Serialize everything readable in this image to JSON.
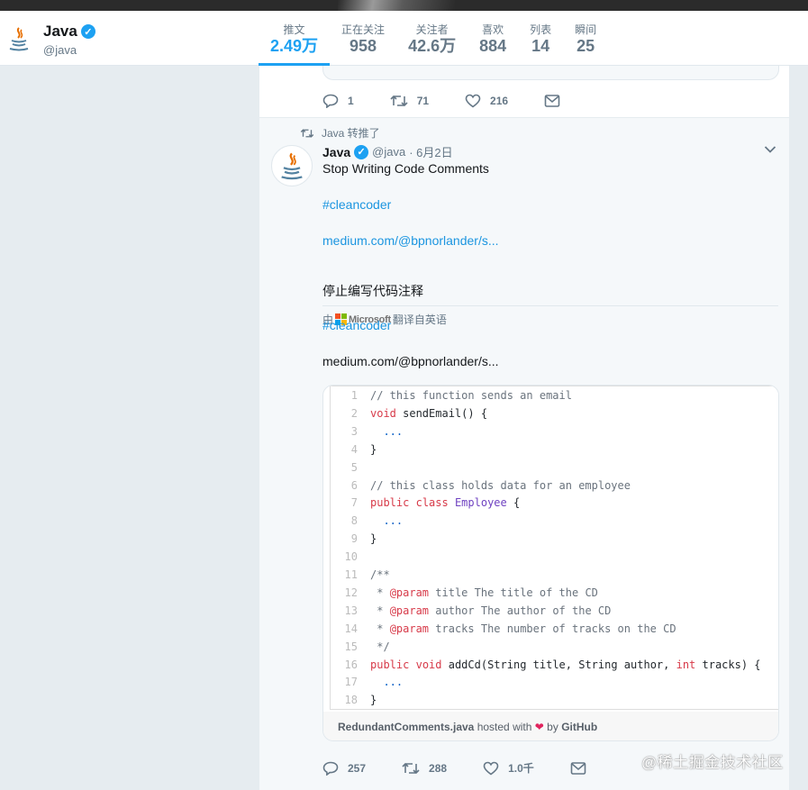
{
  "profile": {
    "name": "Java",
    "handle": "@java"
  },
  "stats": [
    {
      "label": "推文",
      "value": "2.49万"
    },
    {
      "label": "正在关注",
      "value": "958"
    },
    {
      "label": "关注者",
      "value": "42.6万"
    },
    {
      "label": "喜欢",
      "value": "884"
    },
    {
      "label": "列表",
      "value": "14"
    },
    {
      "label": "瞬间",
      "value": "25"
    }
  ],
  "prev_actions": {
    "reply": "1",
    "retweet": "71",
    "like": "216"
  },
  "tweet": {
    "retweeted_by": "Java 转推了",
    "name": "Java",
    "handle": "@java",
    "date": "· 6月2日",
    "text_line1": "Stop Writing Code Comments",
    "hashtag": "#cleancoder",
    "url": "medium.com/@bpnorlander/s...",
    "translate_prefix": "由",
    "translate_brand": "Microsoft",
    "translate_suffix": "翻译自英语",
    "translated_line1": "停止编写代码注释",
    "translated_hashtag": "#cleancoder",
    "translated_url": "medium.com/@bpnorlander/s...",
    "actions": {
      "reply": "257",
      "retweet": "288",
      "like": "1.0千"
    }
  },
  "gist": {
    "lines": [
      {
        "n": "1",
        "parts": [
          {
            "t": "// this function sends an email",
            "c": "c-com"
          }
        ]
      },
      {
        "n": "2",
        "parts": [
          {
            "t": "void",
            "c": "c-kw"
          },
          {
            "t": " sendEmail() {",
            "c": "c-pl"
          }
        ]
      },
      {
        "n": "3",
        "parts": [
          {
            "t": "  ...",
            "c": "c-dots"
          }
        ]
      },
      {
        "n": "4",
        "parts": [
          {
            "t": "}",
            "c": "c-pl"
          }
        ]
      },
      {
        "n": "5",
        "parts": []
      },
      {
        "n": "6",
        "parts": [
          {
            "t": "// this class holds data for an employee",
            "c": "c-com"
          }
        ]
      },
      {
        "n": "7",
        "parts": [
          {
            "t": "public",
            "c": "c-kw"
          },
          {
            "t": " ",
            "c": "c-pl"
          },
          {
            "t": "class",
            "c": "c-kw"
          },
          {
            "t": " ",
            "c": "c-pl"
          },
          {
            "t": "Employee",
            "c": "c-cls"
          },
          {
            "t": " {",
            "c": "c-pl"
          }
        ]
      },
      {
        "n": "8",
        "parts": [
          {
            "t": "  ...",
            "c": "c-dots"
          }
        ]
      },
      {
        "n": "9",
        "parts": [
          {
            "t": "}",
            "c": "c-pl"
          }
        ]
      },
      {
        "n": "10",
        "parts": []
      },
      {
        "n": "11",
        "parts": [
          {
            "t": "/**",
            "c": "c-com"
          }
        ]
      },
      {
        "n": "12",
        "parts": [
          {
            "t": " * ",
            "c": "c-com"
          },
          {
            "t": "@param",
            "c": "c-kw"
          },
          {
            "t": " title The title of the CD",
            "c": "c-com"
          }
        ]
      },
      {
        "n": "13",
        "parts": [
          {
            "t": " * ",
            "c": "c-com"
          },
          {
            "t": "@param",
            "c": "c-kw"
          },
          {
            "t": " author The author of the CD",
            "c": "c-com"
          }
        ]
      },
      {
        "n": "14",
        "parts": [
          {
            "t": " * ",
            "c": "c-com"
          },
          {
            "t": "@param",
            "c": "c-kw"
          },
          {
            "t": " tracks The number of tracks on the CD",
            "c": "c-com"
          }
        ]
      },
      {
        "n": "15",
        "parts": [
          {
            "t": " */",
            "c": "c-com"
          }
        ]
      },
      {
        "n": "16",
        "parts": [
          {
            "t": "public",
            "c": "c-kw"
          },
          {
            "t": " ",
            "c": "c-pl"
          },
          {
            "t": "void",
            "c": "c-kw"
          },
          {
            "t": " addCd(String title, String author, ",
            "c": "c-pl"
          },
          {
            "t": "int",
            "c": "c-kw"
          },
          {
            "t": " tracks) {",
            "c": "c-pl"
          }
        ]
      },
      {
        "n": "17",
        "parts": [
          {
            "t": "  ...",
            "c": "c-dots"
          }
        ]
      },
      {
        "n": "18",
        "parts": [
          {
            "t": "}",
            "c": "c-pl"
          }
        ]
      }
    ],
    "footer_file": "RedundantComments.java",
    "footer_hosted": "hosted with",
    "footer_by": "by",
    "footer_github": "GitHub"
  },
  "watermark": "@稀土掘金技术社区",
  "colors": {
    "accent": "#1da1f2",
    "like": "#e0245e"
  }
}
